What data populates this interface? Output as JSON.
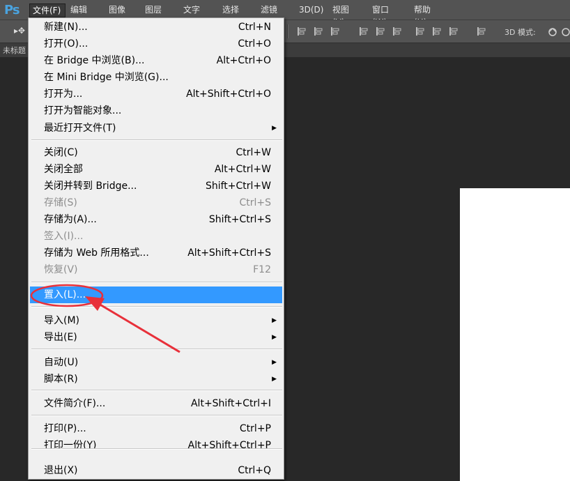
{
  "app": {
    "logo": "Ps"
  },
  "menubar": [
    {
      "label": "文件(F)",
      "active": true
    },
    {
      "label": "编辑(E)"
    },
    {
      "label": "图像(I)"
    },
    {
      "label": "图层(L)"
    },
    {
      "label": "文字(Y)"
    },
    {
      "label": "选择(S)"
    },
    {
      "label": "滤镜(T)"
    },
    {
      "label": "3D(D)"
    },
    {
      "label": "视图(V)"
    },
    {
      "label": "窗口(W)"
    },
    {
      "label": "帮助(H)"
    }
  ],
  "options_bar": {
    "mode_label": "3D 模式:"
  },
  "tab": {
    "label": "未标题"
  },
  "file_menu": {
    "groups": [
      [
        {
          "label": "新建(N)...",
          "shortcut": "Ctrl+N"
        },
        {
          "label": "打开(O)...",
          "shortcut": "Ctrl+O"
        },
        {
          "label": "在 Bridge 中浏览(B)...",
          "shortcut": "Alt+Ctrl+O"
        },
        {
          "label": "在 Mini Bridge 中浏览(G)...",
          "shortcut": ""
        },
        {
          "label": "打开为...",
          "shortcut": "Alt+Shift+Ctrl+O"
        },
        {
          "label": "打开为智能对象...",
          "shortcut": ""
        },
        {
          "label": "最近打开文件(T)",
          "shortcut": "",
          "submenu": true
        }
      ],
      [
        {
          "label": "关闭(C)",
          "shortcut": "Ctrl+W"
        },
        {
          "label": "关闭全部",
          "shortcut": "Alt+Ctrl+W"
        },
        {
          "label": "关闭并转到 Bridge...",
          "shortcut": "Shift+Ctrl+W"
        },
        {
          "label": "存储(S)",
          "shortcut": "Ctrl+S",
          "disabled": true
        },
        {
          "label": "存储为(A)...",
          "shortcut": "Shift+Ctrl+S"
        },
        {
          "label": "签入(I)...",
          "shortcut": "",
          "disabled": true
        },
        {
          "label": "存储为 Web 所用格式...",
          "shortcut": "Alt+Shift+Ctrl+S"
        },
        {
          "label": "恢复(V)",
          "shortcut": "F12",
          "disabled": true
        }
      ],
      [
        {
          "label": "置入(L)...",
          "shortcut": "",
          "highlighted": true
        }
      ],
      [
        {
          "label": "导入(M)",
          "shortcut": "",
          "submenu": true
        },
        {
          "label": "导出(E)",
          "shortcut": "",
          "submenu": true
        }
      ],
      [
        {
          "label": "自动(U)",
          "shortcut": "",
          "submenu": true
        },
        {
          "label": "脚本(R)",
          "shortcut": "",
          "submenu": true
        }
      ],
      [
        {
          "label": "文件简介(F)...",
          "shortcut": "Alt+Shift+Ctrl+I"
        }
      ],
      [
        {
          "label": "打印(P)...",
          "shortcut": "Ctrl+P"
        },
        {
          "label": "打印一份(Y)",
          "shortcut": "Alt+Shift+Ctrl+P"
        }
      ],
      [
        {
          "label": "退出(X)",
          "shortcut": "Ctrl+Q"
        }
      ]
    ]
  },
  "colors": {
    "highlight": "#3399ff",
    "annotation": "#e8303a",
    "menubar": "#535353",
    "workspace": "#282828"
  }
}
